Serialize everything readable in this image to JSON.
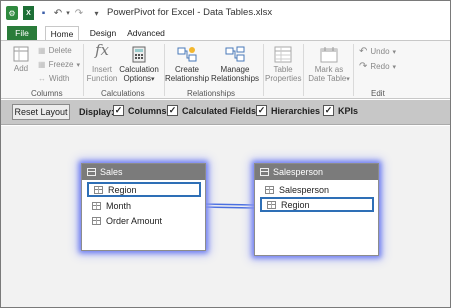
{
  "window": {
    "title": "PowerPivot for Excel - Data Tables.xlsx"
  },
  "tabs": [
    "File",
    "Home",
    "Design",
    "Advanced"
  ],
  "ribbon": {
    "columns_group": {
      "add": "Add",
      "delete": "Delete",
      "freeze": "Freeze",
      "width": "Width",
      "label": "Columns"
    },
    "calculations_group": {
      "insert_function": "Insert Function",
      "calculation_options": "Calculation Options",
      "label": "Calculations"
    },
    "relationships_group": {
      "create": "Create Relationship",
      "manage": "Manage Relationships",
      "label": "Relationships"
    },
    "table_group": {
      "table_properties": "Table Properties"
    },
    "date_group": {
      "mark_as_date_table": "Mark as Date Table"
    },
    "edit_group": {
      "undo": "Undo",
      "redo": "Redo",
      "label": "Edit"
    }
  },
  "display_bar": {
    "reset_layout": "Reset Layout",
    "display_label": "Display:",
    "options": [
      {
        "label": "Columns",
        "checked": true
      },
      {
        "label": "Calculated Fields",
        "checked": true
      },
      {
        "label": "Hierarchies",
        "checked": true
      },
      {
        "label": "KPIs",
        "checked": true
      }
    ]
  },
  "diagram": {
    "tables": [
      {
        "name": "Sales",
        "fields": [
          "Region",
          "Month",
          "Order Amount"
        ],
        "selected_field": "Region"
      },
      {
        "name": "Salesperson",
        "fields": [
          "Salesperson",
          "Region"
        ],
        "selected_field": "Region"
      }
    ]
  },
  "colors": {
    "file_tab": "#2a7c3a",
    "glow": "#6f7ff0",
    "selection": "#2e6fb6",
    "table_header": "#7b7b7b"
  }
}
